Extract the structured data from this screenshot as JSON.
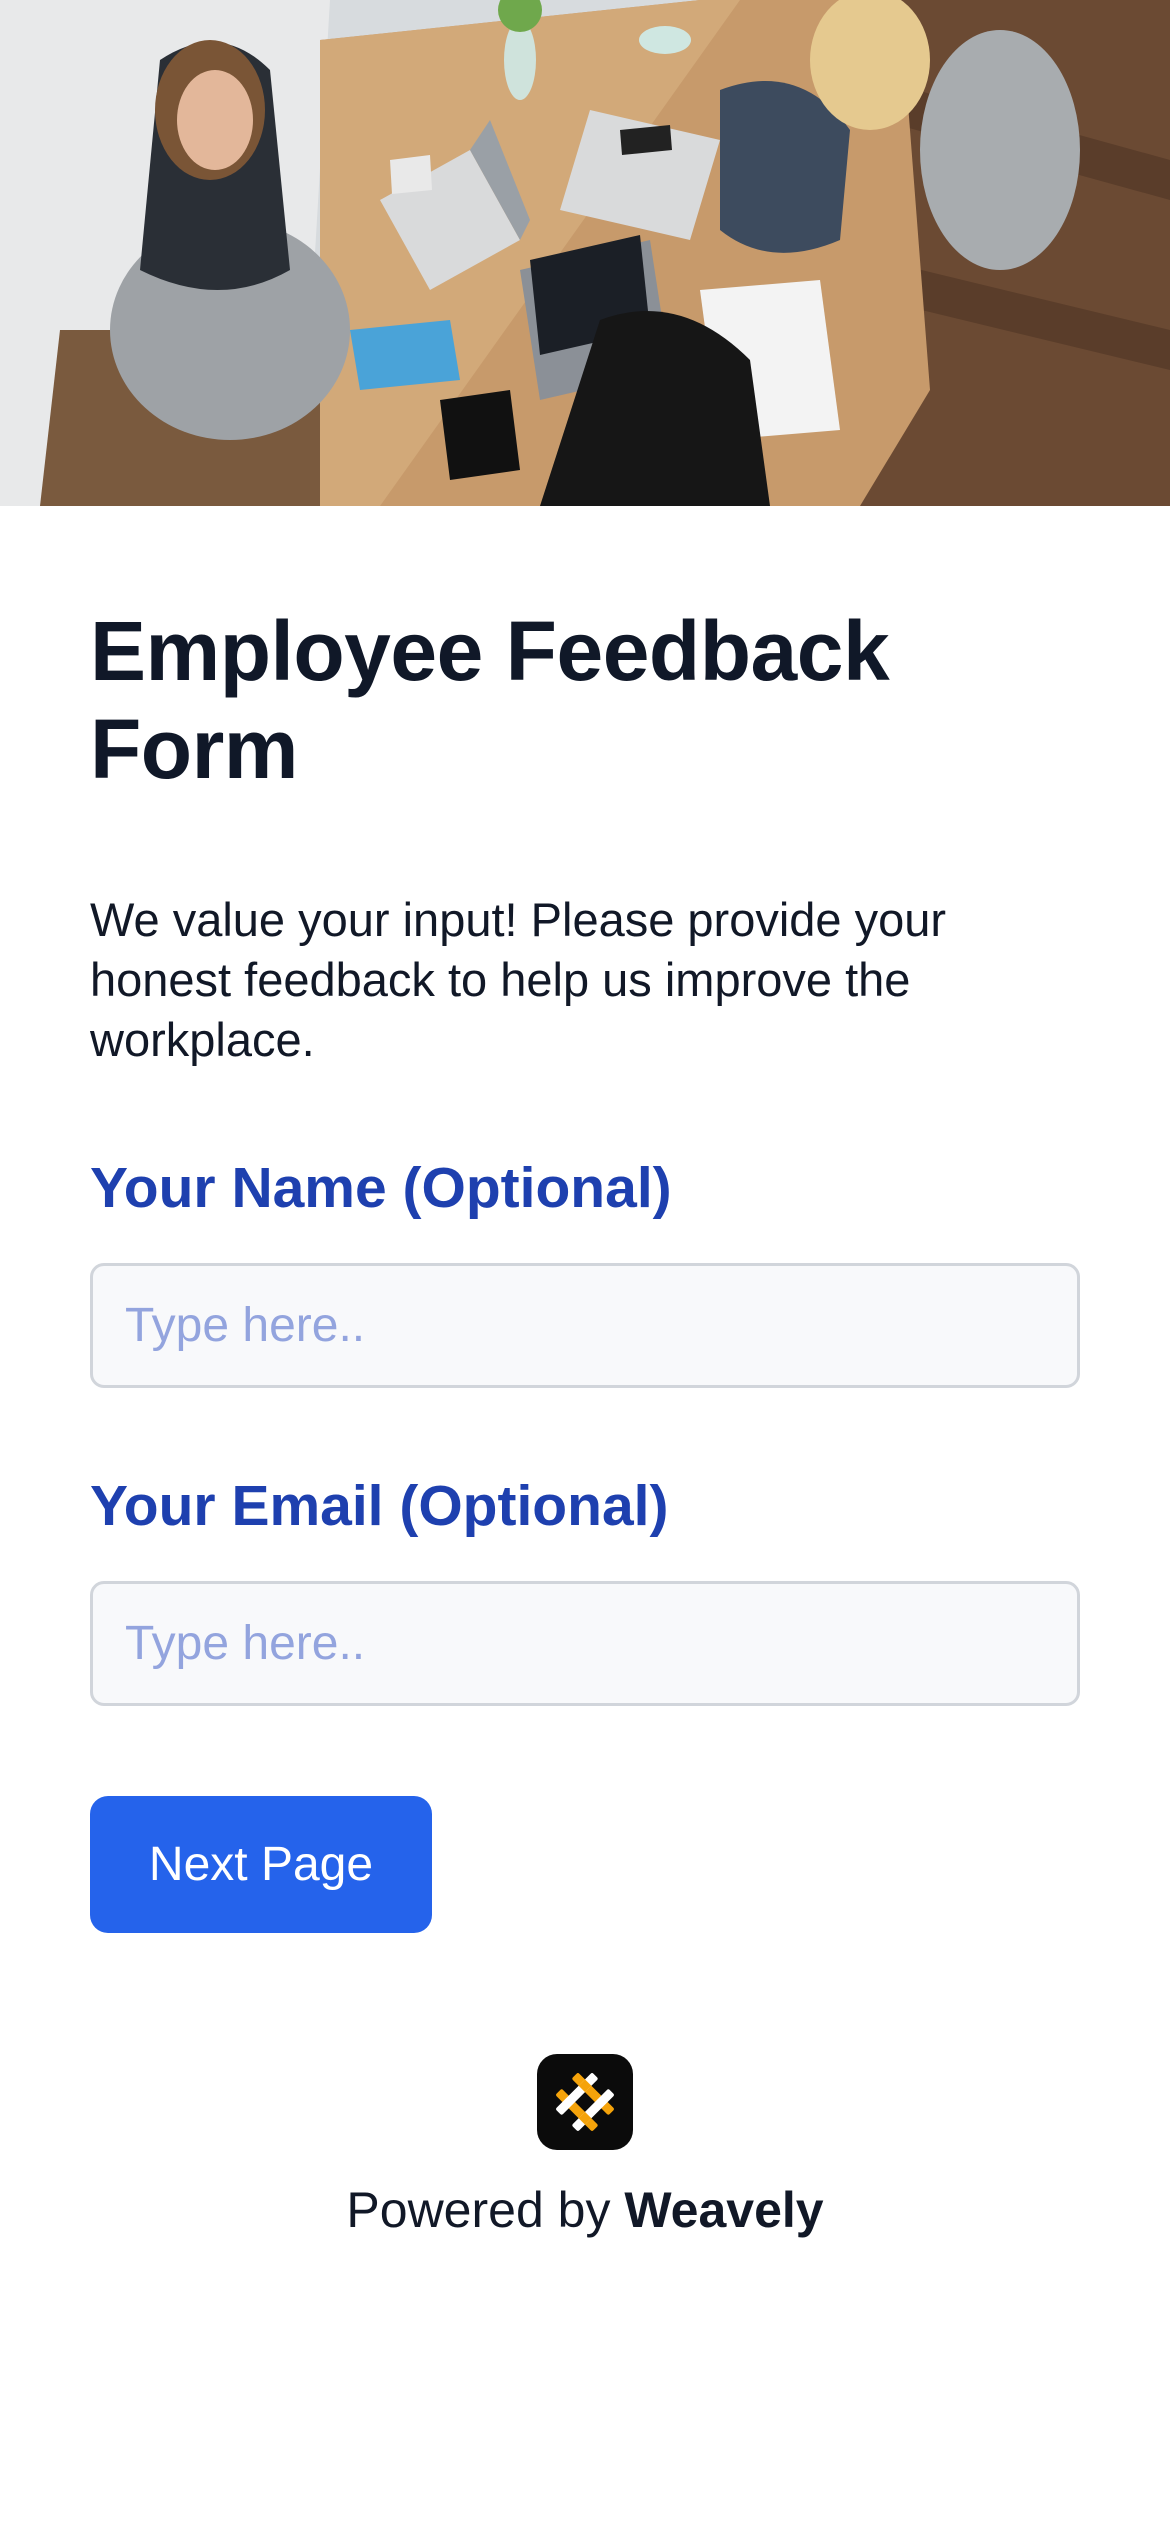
{
  "hero": {
    "image": "office-meeting-photo"
  },
  "form": {
    "title": "Employee Feedback Form",
    "description": "We value your input! Please provide your honest feedback to help us improve the workplace.",
    "fields": [
      {
        "label": "Your Name (Optional)",
        "placeholder": "Type here..",
        "value": ""
      },
      {
        "label": "Your Email (Optional)",
        "placeholder": "Type here..",
        "value": ""
      }
    ],
    "next_button_label": "Next Page"
  },
  "footer": {
    "powered_by": "Powered by",
    "brand": "Weavely",
    "logo_icon": "weavely-logo-icon"
  },
  "colors": {
    "accent": "#2563eb",
    "label": "#1e40af",
    "heading": "#101828",
    "placeholder": "#93a4de",
    "logo_accent": "#f5a30a"
  }
}
